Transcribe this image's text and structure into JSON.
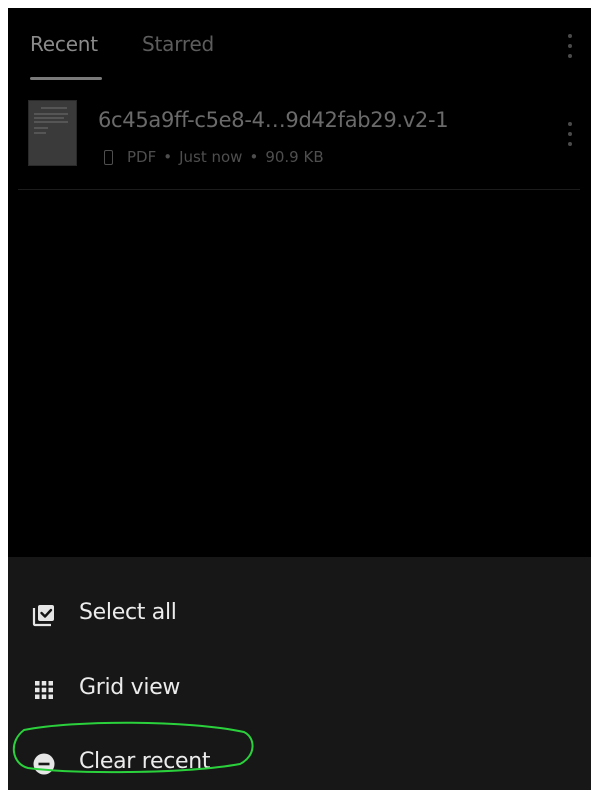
{
  "tabs": [
    {
      "label": "Recent",
      "active": true
    },
    {
      "label": "Starred",
      "active": false
    }
  ],
  "file": {
    "name": "6c45a9ff-c5e8-4…9d42fab29.v2-1",
    "type": "PDF",
    "modified": "Just now",
    "size": "90.9 KB",
    "separator": "•"
  },
  "menu": {
    "select_all": "Select all",
    "grid_view": "Grid view",
    "clear_recent": "Clear recent"
  },
  "colors": {
    "background": "#000000",
    "sheet": "#171717",
    "highlight": "#2bd13c"
  },
  "icons": [
    "more-vertical-icon",
    "device-icon",
    "select-all-icon",
    "grid-icon",
    "remove-circle-icon"
  ]
}
